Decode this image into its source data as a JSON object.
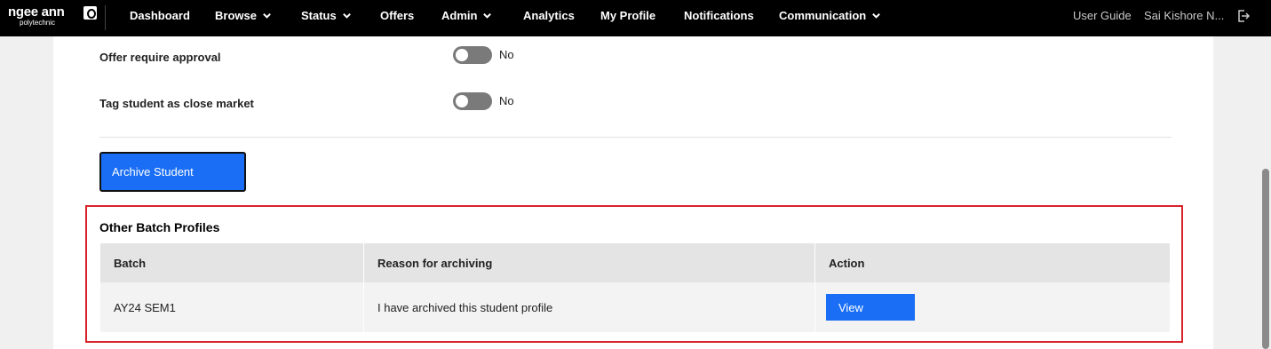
{
  "nav": {
    "logo_text": "ngee ann",
    "logo_sub": "polytechnic",
    "items": [
      {
        "label": "Dashboard",
        "dropdown": false
      },
      {
        "label": "Browse",
        "dropdown": true
      },
      {
        "label": "Status",
        "dropdown": true
      },
      {
        "label": "Offers",
        "dropdown": false
      },
      {
        "label": "Admin",
        "dropdown": true
      },
      {
        "label": "Analytics",
        "dropdown": false
      },
      {
        "label": "My Profile",
        "dropdown": false
      },
      {
        "label": "Notifications",
        "dropdown": false
      },
      {
        "label": "Communication",
        "dropdown": true
      }
    ],
    "user_guide": "User Guide",
    "user_name": "Sai Kishore N...",
    "logout_icon": "logout-icon"
  },
  "settings": {
    "offer_approval": {
      "label": "Offer require approval",
      "value": "No"
    },
    "close_market": {
      "label": "Tag student as close market",
      "value": "No"
    }
  },
  "archive_button": "Archive Student",
  "batch_profiles": {
    "title": "Other Batch Profiles",
    "columns": [
      "Batch",
      "Reason for archiving",
      "Action"
    ],
    "rows": [
      {
        "batch": "AY24 SEM1",
        "reason": "I have archived this student profile",
        "action": "View"
      }
    ]
  },
  "colors": {
    "nav_bg": "#000000",
    "primary_button": "#1a6ef5",
    "highlight": "#d8222a",
    "toggle_off": "#7a7a7a"
  }
}
